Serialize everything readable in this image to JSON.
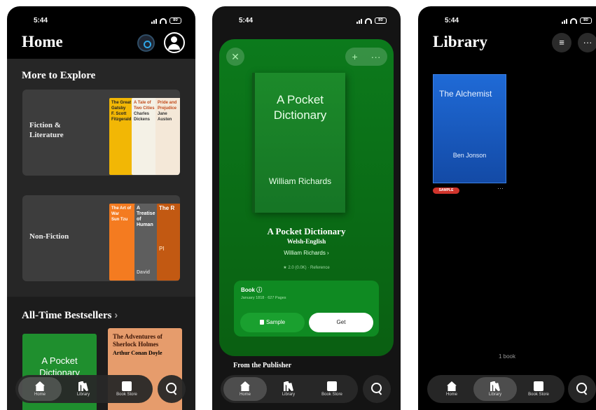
{
  "status": {
    "time": "5:44",
    "battery": "80"
  },
  "home": {
    "title": "Home",
    "more_to_explore": "More to Explore",
    "categories": [
      {
        "label": "Fiction & Literature",
        "books": [
          {
            "title": "The Great Gatsby",
            "author": "F. Scott Fitzgerald",
            "color": "#f2b705"
          },
          {
            "title": "A Tale of Two Cities",
            "author": "Charles Dickens",
            "color": "#f4f1e6"
          },
          {
            "title": "Pride and Prejudice",
            "author": "Jane Austen",
            "color": "#f4e8d8"
          }
        ]
      },
      {
        "label": "Non-Fiction",
        "books": [
          {
            "title": "The Art of War",
            "author": "Sun Tzu",
            "color": "#f47b20"
          },
          {
            "title": "A Treatise of Human",
            "author": "David",
            "color": "#5e5e5e"
          },
          {
            "title": "The R",
            "author": "Pl",
            "color": "#c25912"
          }
        ]
      }
    ],
    "bestsellers_title": "All-Time Bestsellers",
    "bestsellers_chevron": "›",
    "bestsellers": [
      {
        "title": "A Pocket Dictionary"
      },
      {
        "title": "The Adventures of Sherlock Holmes",
        "author": "Arthur Conan Doyle"
      }
    ]
  },
  "tabs": {
    "home": "Home",
    "library": "Library",
    "store": "Book Store"
  },
  "detail": {
    "close": "✕",
    "plus": "+",
    "more": "···",
    "cover_title": "A Pocket Dictionary",
    "cover_author": "William Richards",
    "title": "A Pocket Dictionary",
    "subtitle": "Welsh-English",
    "author": "William Richards ›",
    "rating": "★ 2.0 (0.0K) · Reference",
    "format": "Book ⓘ",
    "format_meta": "January 1818 · 627 Pages",
    "sample_btn": "Sample",
    "get_btn": "Get",
    "from_publisher": "From the Publisher"
  },
  "library": {
    "title": "Library",
    "book": {
      "title": "The Alchemist",
      "author": "Ben Jonson",
      "badge": "SAMPLE"
    },
    "count": "1 book"
  }
}
